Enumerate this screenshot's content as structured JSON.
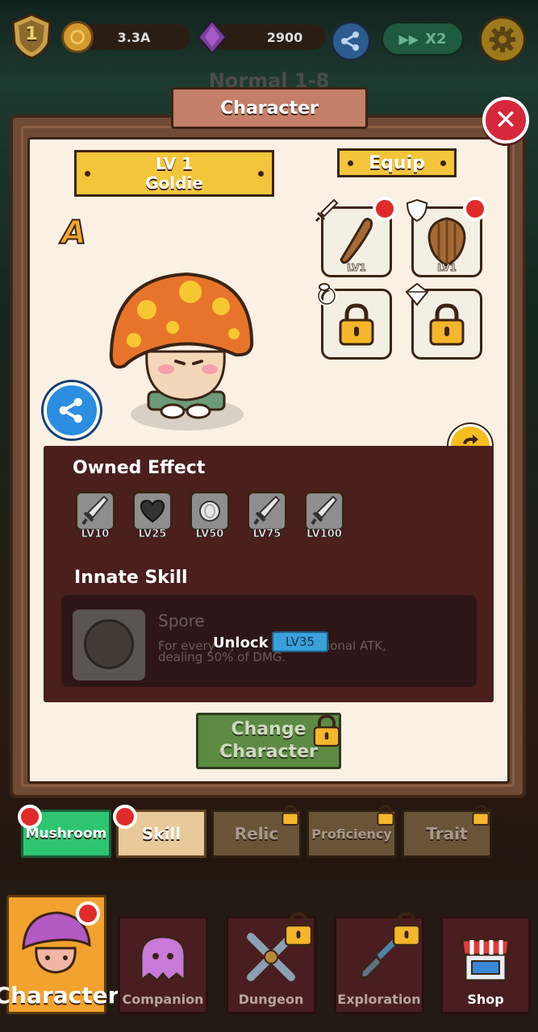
{
  "header": {
    "level": "1",
    "coins": "3.3A",
    "gems": "2900",
    "speed": "X2"
  },
  "stage": {
    "title": "Normal  1-8"
  },
  "panel": {
    "title": "Character",
    "close_icon": "close-x-icon"
  },
  "character": {
    "level": "LV 1",
    "name": "Goldie",
    "grade": "A"
  },
  "equip": {
    "title": "Equip",
    "slots": [
      {
        "type": "weapon",
        "icon": "club-icon",
        "level": "LV1",
        "locked": false,
        "has_alert": true
      },
      {
        "type": "armor",
        "icon": "wooden-shield-icon",
        "level": "LV1",
        "locked": false,
        "has_alert": true
      },
      {
        "type": "accessory",
        "icon": "lock-icon",
        "level": "",
        "locked": true,
        "has_alert": false
      },
      {
        "type": "relic",
        "icon": "lock-icon",
        "level": "",
        "locked": true,
        "has_alert": false
      }
    ]
  },
  "owned_effect": {
    "title": "Owned Effect",
    "items": [
      {
        "icon": "sword-icon",
        "level": "LV10"
      },
      {
        "icon": "heart-icon",
        "level": "LV25"
      },
      {
        "icon": "coin-icon",
        "level": "LV50"
      },
      {
        "icon": "sword-icon",
        "level": "LV75"
      },
      {
        "icon": "sword-icon",
        "level": "LV100"
      }
    ]
  },
  "innate_skill": {
    "title": "Innate Skill",
    "name": "Spore",
    "desc_line1": "For every    ,                additional ATK,",
    "desc_line2": "dealing 50% of DMG.",
    "unlock_label": "Unlock",
    "unlock_level": "LV35"
  },
  "change_button": {
    "line1": "Change",
    "line2": "Character"
  },
  "subtabs": [
    {
      "label": "Mushroom",
      "active": true,
      "alert": true,
      "locked": false
    },
    {
      "label": "Skill",
      "active": false,
      "alert": true,
      "locked": false
    },
    {
      "label": "Relic",
      "active": false,
      "alert": false,
      "locked": true
    },
    {
      "label": "Proficiency",
      "active": false,
      "alert": false,
      "locked": true
    },
    {
      "label": "Trait",
      "active": false,
      "alert": false,
      "locked": true
    }
  ],
  "nav": [
    {
      "label": "Character",
      "active": true
    },
    {
      "label": "Companion",
      "active": false
    },
    {
      "label": "Dungeon",
      "active": false
    },
    {
      "label": "Exploration",
      "active": false
    },
    {
      "label": "Shop",
      "active": false
    }
  ],
  "colors": {
    "panel_paper": "#fbf0e4",
    "ribbon_yellow": "#f3c53a",
    "effect_panel": "#4a1f1d",
    "active_tab_green": "#2ec571",
    "active_nav_orange": "#f2a22e",
    "alert_red": "#e12b2b"
  }
}
